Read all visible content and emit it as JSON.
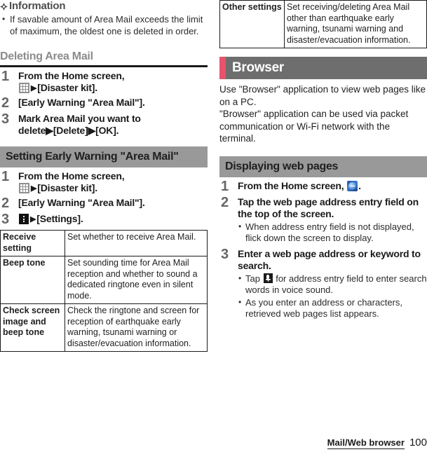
{
  "footer": {
    "breadcrumb": "Mail/Web browser",
    "page_number": "100"
  },
  "left_column": {
    "information": {
      "heading": "Information",
      "bullets": [
        "If savable amount of Area Mail exceeds the limit of maximum, the oldest one is deleted in order."
      ]
    },
    "deleting_area_mail": {
      "heading": "Deleting Area Mail",
      "steps": [
        {
          "num": "1",
          "text_before": "From the Home screen,",
          "icon": "app-drawer-icon",
          "text_after": "[Disaster kit]."
        },
        {
          "num": "2",
          "text": "[Early Warning \"Area Mail\"]."
        },
        {
          "num": "3",
          "text": "Mark Area Mail you want to delete▶[Delete]▶[OK]."
        }
      ]
    },
    "setting_early_warning": {
      "heading": "Setting Early Warning \"Area Mail\"",
      "steps": [
        {
          "num": "1",
          "text_before": "From the Home screen,",
          "icon": "app-drawer-icon",
          "text_after": "[Disaster kit]."
        },
        {
          "num": "2",
          "text": "[Early Warning \"Area Mail\"]."
        },
        {
          "num": "3",
          "icon": "menu-dots-icon",
          "text_after": "[Settings]."
        }
      ],
      "table": {
        "rows": [
          {
            "key": "Receive setting",
            "value": "Set whether to receive Area Mail."
          },
          {
            "key": "Beep tone",
            "value": "Set sounding time for Area Mail reception and whether to sound a dedicated ringtone even in silent mode."
          },
          {
            "key": "Check screen image and beep tone",
            "value": "Check the ringtone and screen for reception of earthquake early warning, tsunami warning or disaster/evacuation information."
          }
        ]
      }
    }
  },
  "right_column": {
    "continued_table": {
      "rows": [
        {
          "key": "Other settings",
          "value": "Set receiving/deleting Area Mail other than earthquake early warning, tsunami warning and disaster/evacuation information."
        }
      ]
    },
    "browser_section": {
      "title": "Browser",
      "accent_color": "#e8536b",
      "banner_color": "#6e6e6e",
      "paragraphs": [
        "Use \"Browser\" application to view web pages like on a PC.",
        "\"Browser\" application can be used via packet communication or Wi-Fi network with the terminal."
      ]
    },
    "displaying_web_pages": {
      "heading": "Displaying web pages",
      "steps": [
        {
          "num": "1",
          "text_before": "From the Home screen,",
          "icon": "browser-icon",
          "text_after": "."
        },
        {
          "num": "2",
          "text": "Tap the web page address entry field on the top of the screen.",
          "subbullets": [
            "When address entry field is not displayed, flick down the screen to display."
          ]
        },
        {
          "num": "3",
          "text": "Enter a web page address or keyword to search.",
          "subbullets_split": {
            "first_before": "Tap",
            "first_icon": "microphone-icon",
            "first_after": "for address entry field to enter search words in voice sound.",
            "second": "As you enter an address or characters, retrieved web pages list appears."
          }
        }
      ]
    }
  }
}
